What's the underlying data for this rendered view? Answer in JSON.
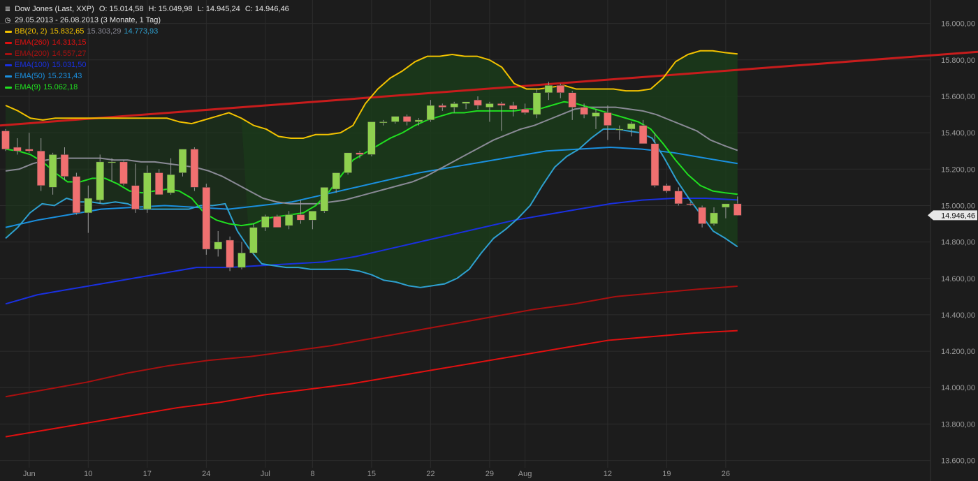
{
  "header": {
    "instrument": "Dow Jones (Last, XXP)",
    "open": "O: 15.014,58",
    "high": "H: 15.049,98",
    "low": "L: 14.945,24",
    "close": "C: 14.946,46",
    "range": "29.05.2013 - 26.08.2013 (3 Monate, 1 Tag)"
  },
  "legend": [
    {
      "label": "BB(20, 2)",
      "color": "#f2c200",
      "values": [
        {
          "text": "15.832,65",
          "color": "#f2c200"
        },
        {
          "text": "15.303,29",
          "color": "#8a8a96"
        },
        {
          "text": "14.773,93",
          "color": "#2ea0d0"
        }
      ]
    },
    {
      "label": "EMA(260)",
      "color": "#e01010",
      "values": [
        {
          "text": "14.313,15",
          "color": "#e01010"
        }
      ]
    },
    {
      "label": "EMA(200)",
      "color": "#a81010",
      "values": [
        {
          "text": "14.557,27",
          "color": "#a81010"
        }
      ]
    },
    {
      "label": "EMA(100)",
      "color": "#1a30e0",
      "values": [
        {
          "text": "15.031,50",
          "color": "#1a30e0"
        }
      ]
    },
    {
      "label": "EMA(50)",
      "color": "#1a90e0",
      "values": [
        {
          "text": "15.231,43",
          "color": "#1a90e0"
        }
      ]
    },
    {
      "label": "EMA(9)",
      "color": "#20e020",
      "values": [
        {
          "text": "15.062,18",
          "color": "#20e020"
        }
      ]
    }
  ],
  "colors": {
    "background": "#1c1c1c",
    "grid": "#2c2c2c",
    "axis_text": "#9a9a9a",
    "bull": "#8fd14f",
    "bear": "#f07070",
    "band_fill": "#1b3a1b",
    "bb_upper": "#f2c200",
    "bb_mid": "#8a8a96",
    "bb_lower": "#2ea0d0",
    "trendline": "#c81c1c",
    "ema260": "#e01010",
    "ema200": "#a81010",
    "ema100": "#1a30e0",
    "ema50": "#1a90e0",
    "ema9": "#20e020",
    "price_tag_bg": "#e8e8e8",
    "price_tag_text": "#111111"
  },
  "chart_data": {
    "type": "candlestick",
    "title": "Dow Jones (Last, XXP)",
    "period": "29.05.2013 - 26.08.2013",
    "ylim": [
      13560,
      16060
    ],
    "y_ticks": [
      13600,
      13800,
      14000,
      14200,
      14400,
      14600,
      14800,
      15000,
      15200,
      15400,
      15600,
      15800,
      16000
    ],
    "y_tick_labels": [
      "13.600,00",
      "13.800,00",
      "14.000,00",
      "14.200,00",
      "14.400,00",
      "14.600,00",
      "14.800,00",
      "15.000,00",
      "15.200,00",
      "15.400,00",
      "15.600,00",
      "15.800,00",
      "16.000,00"
    ],
    "x_ticks": [
      {
        "i": 2,
        "label": "Jun"
      },
      {
        "i": 7,
        "label": "10"
      },
      {
        "i": 12,
        "label": "17"
      },
      {
        "i": 17,
        "label": "24"
      },
      {
        "i": 22,
        "label": "Jul"
      },
      {
        "i": 26,
        "label": "8"
      },
      {
        "i": 31,
        "label": "15"
      },
      {
        "i": 36,
        "label": "22"
      },
      {
        "i": 41,
        "label": "29"
      },
      {
        "i": 44,
        "label": "Aug"
      },
      {
        "i": 51,
        "label": "12"
      },
      {
        "i": 56,
        "label": "19"
      },
      {
        "i": 61,
        "label": "26"
      }
    ],
    "last_price_label": "14.946,46",
    "last_price": 14946.46,
    "grid": true,
    "legend_position": "top-left",
    "candles": [
      [
        15410,
        15420,
        15300,
        15310
      ],
      [
        15320,
        15370,
        15280,
        15300
      ],
      [
        15310,
        15400,
        15290,
        15300
      ],
      [
        15300,
        15370,
        15080,
        15110
      ],
      [
        15100,
        15290,
        15060,
        15280
      ],
      [
        15280,
        15320,
        15140,
        15160
      ],
      [
        15160,
        15180,
        14950,
        14960
      ],
      [
        14960,
        15110,
        14850,
        15040
      ],
      [
        15030,
        15280,
        15010,
        15240
      ],
      [
        15240,
        15260,
        15130,
        15240
      ],
      [
        15240,
        15250,
        15110,
        15120
      ],
      [
        15110,
        15230,
        14960,
        14980
      ],
      [
        14980,
        15220,
        14960,
        15180
      ],
      [
        15180,
        15200,
        15060,
        15060
      ],
      [
        15070,
        15260,
        15060,
        15170
      ],
      [
        15180,
        15310,
        15160,
        15310
      ],
      [
        15310,
        15320,
        15080,
        15100
      ],
      [
        15100,
        15120,
        14730,
        14760
      ],
      [
        14760,
        14860,
        14720,
        14800
      ],
      [
        14810,
        14830,
        14640,
        14660
      ],
      [
        14660,
        14800,
        14650,
        14740
      ],
      [
        14740,
        14900,
        14730,
        14880
      ],
      [
        14880,
        14950,
        14860,
        14940
      ],
      [
        14940,
        14950,
        14880,
        14880
      ],
      [
        14890,
        14970,
        14870,
        14950
      ],
      [
        14950,
        15030,
        14900,
        14920
      ],
      [
        14920,
        14940,
        14870,
        14970
      ],
      [
        14970,
        15100,
        14960,
        15100
      ],
      [
        15090,
        15180,
        15070,
        15180
      ],
      [
        15180,
        15290,
        15170,
        15290
      ],
      [
        15290,
        15300,
        15260,
        15280
      ],
      [
        15280,
        15460,
        15270,
        15460
      ],
      [
        15460,
        15470,
        15440,
        15460
      ],
      [
        15460,
        15490,
        15450,
        15490
      ],
      [
        15490,
        15500,
        15440,
        15460
      ],
      [
        15460,
        15480,
        15440,
        15470
      ],
      [
        15470,
        15580,
        15460,
        15550
      ],
      [
        15550,
        15560,
        15520,
        15540
      ],
      [
        15540,
        15570,
        15510,
        15560
      ],
      [
        15560,
        15570,
        15530,
        15570
      ],
      [
        15580,
        15600,
        15530,
        15550
      ],
      [
        15540,
        15570,
        15460,
        15560
      ],
      [
        15560,
        15570,
        15410,
        15550
      ],
      [
        15550,
        15570,
        15490,
        15530
      ],
      [
        15530,
        15560,
        15500,
        15510
      ],
      [
        15500,
        15640,
        15480,
        15620
      ],
      [
        15620,
        15680,
        15580,
        15660
      ],
      [
        15660,
        15670,
        15590,
        15620
      ],
      [
        15620,
        15630,
        15470,
        15540
      ],
      [
        15540,
        15560,
        15480,
        15500
      ],
      [
        15490,
        15530,
        15420,
        15510
      ],
      [
        15510,
        15550,
        15360,
        15440
      ],
      [
        15420,
        15440,
        15360,
        15420
      ],
      [
        15420,
        15460,
        15380,
        15450
      ],
      [
        15440,
        15470,
        15340,
        15340
      ],
      [
        15340,
        15400,
        15100,
        15110
      ],
      [
        15110,
        15120,
        15070,
        15080
      ],
      [
        15080,
        15100,
        15000,
        15010
      ],
      [
        15010,
        15020,
        15000,
        15005
      ],
      [
        14990,
        15000,
        14880,
        14900
      ],
      [
        14900,
        14990,
        14890,
        14960
      ],
      [
        14990,
        15010,
        14930,
        15010
      ],
      [
        15010,
        15050,
        14945,
        14946
      ]
    ],
    "series": [
      {
        "name": "BB(20, 2)",
        "line": "upper",
        "color": "#f2c200",
        "values": [
          15550,
          15520,
          15480,
          15470,
          15480,
          15480,
          15480,
          15480,
          15480,
          15480,
          15480,
          15480,
          15480,
          15480,
          15460,
          15450,
          15470,
          15490,
          15510,
          15480,
          15440,
          15420,
          15380,
          15370,
          15370,
          15390,
          15390,
          15400,
          15440,
          15560,
          15640,
          15700,
          15740,
          15790,
          15820,
          15820,
          15830,
          15820,
          15820,
          15800,
          15760,
          15670,
          15640,
          15640,
          15650,
          15660,
          15640,
          15640,
          15640,
          15640,
          15630,
          15630,
          15640,
          15700,
          15790,
          15830,
          15850,
          15850,
          15840,
          15833
        ]
      },
      {
        "name": "BB(20, 2)",
        "line": "middle",
        "color": "#8a8a96",
        "values": [
          15190,
          15200,
          15230,
          15250,
          15260,
          15260,
          15260,
          15260,
          15250,
          15250,
          15240,
          15240,
          15230,
          15220,
          15210,
          15190,
          15160,
          15120,
          15080,
          15040,
          15020,
          15010,
          15010,
          15010,
          15020,
          15030,
          15050,
          15070,
          15090,
          15110,
          15130,
          15160,
          15200,
          15240,
          15280,
          15320,
          15360,
          15390,
          15420,
          15440,
          15470,
          15500,
          15530,
          15540,
          15540,
          15540,
          15530,
          15520,
          15500,
          15470,
          15440,
          15410,
          15360,
          15330,
          15303
        ]
      },
      {
        "name": "BB(20, 2)",
        "line": "lower",
        "color": "#2ea0d0",
        "values": [
          14820,
          14880,
          14960,
          15010,
          15000,
          15040,
          15020,
          15020,
          15010,
          15020,
          15010,
          14980,
          14980,
          14980,
          14980,
          14980,
          15000,
          15000,
          15010,
          14860,
          14760,
          14680,
          14670,
          14660,
          14660,
          14650,
          14650,
          14650,
          14650,
          14640,
          14620,
          14590,
          14580,
          14560,
          14550,
          14560,
          14570,
          14600,
          14650,
          14740,
          14820,
          14870,
          14930,
          15000,
          15110,
          15210,
          15270,
          15310,
          15370,
          15420,
          15420,
          15410,
          15400,
          15370,
          15260,
          15140,
          15040,
          14950,
          14860,
          14820,
          14774
        ]
      },
      {
        "name": "EMA(260)",
        "color": "#e01010",
        "values": [
          13730,
          13770,
          13810,
          13850,
          13890,
          13920,
          13960,
          13990,
          14020,
          14060,
          14100,
          14140,
          14180,
          14220,
          14260,
          14280,
          14300,
          14313
        ]
      },
      {
        "name": "EMA(200)",
        "color": "#a81010",
        "values": [
          13950,
          13990,
          14030,
          14080,
          14120,
          14150,
          14170,
          14200,
          14230,
          14270,
          14310,
          14350,
          14390,
          14430,
          14460,
          14500,
          14520,
          14540,
          14557
        ]
      },
      {
        "name": "EMA(100)",
        "color": "#1a30e0",
        "values": [
          14460,
          14510,
          14540,
          14570,
          14600,
          14630,
          14660,
          14660,
          14670,
          14680,
          14690,
          14720,
          14760,
          14800,
          14840,
          14880,
          14920,
          14950,
          14980,
          15010,
          15030,
          15040,
          15040,
          15031
        ]
      },
      {
        "name": "EMA(50)",
        "color": "#1a90e0",
        "values": [
          14880,
          14920,
          14950,
          14980,
          14990,
          15000,
          14990,
          14980,
          15000,
          15020,
          15060,
          15100,
          15140,
          15180,
          15210,
          15240,
          15270,
          15300,
          15310,
          15320,
          15310,
          15290,
          15260,
          15231
        ]
      },
      {
        "name": "EMA(9)",
        "color": "#20e020",
        "values": [
          15310,
          15300,
          15280,
          15240,
          15180,
          15130,
          15130,
          15150,
          15150,
          15120,
          15080,
          15070,
          15080,
          15090,
          15080,
          15040,
          14960,
          14920,
          14900,
          14890,
          14900,
          14930,
          14940,
          14950,
          14960,
          15000,
          15070,
          15160,
          15250,
          15290,
          15330,
          15370,
          15400,
          15440,
          15470,
          15490,
          15510,
          15510,
          15520,
          15520,
          15520,
          15520,
          15530,
          15530,
          15550,
          15570,
          15560,
          15540,
          15520,
          15500,
          15480,
          15460,
          15420,
          15340,
          15250,
          15170,
          15110,
          15080,
          15070,
          15062
        ]
      },
      {
        "name": "Trendline",
        "color": "#c81c1c",
        "values": [
          15440,
          15845
        ]
      }
    ]
  }
}
